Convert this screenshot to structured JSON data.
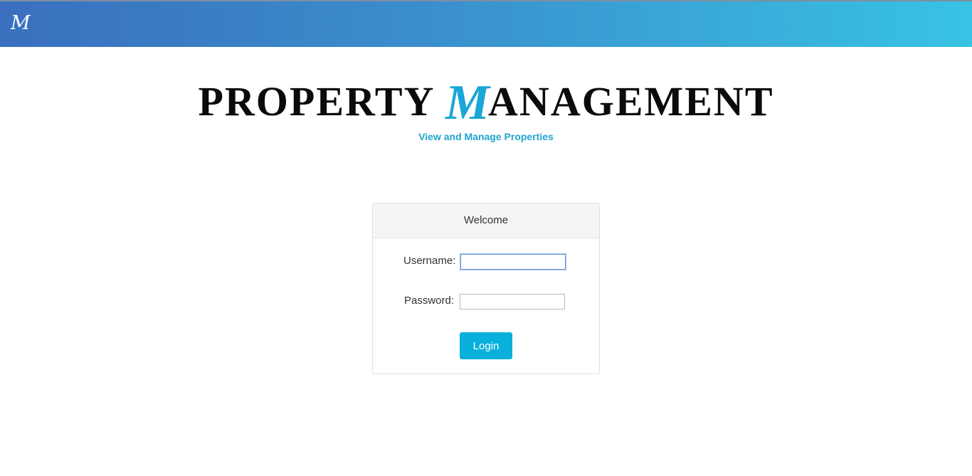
{
  "header": {
    "logo_text": "M"
  },
  "brand": {
    "title_before": "PROPERTY ",
    "title_accent": "M",
    "title_after": "ANAGEMENT",
    "tagline": "View and Manage Properties"
  },
  "login": {
    "card_title": "Welcome",
    "username_label": "Username:",
    "username_value": "",
    "password_label": "Password:",
    "password_value": "",
    "submit_label": "Login"
  },
  "colors": {
    "header_gradient_start": "#3a6fbe",
    "header_gradient_end": "#38c3e3",
    "accent": "#1aa6d6",
    "button": "#09b0dc"
  }
}
